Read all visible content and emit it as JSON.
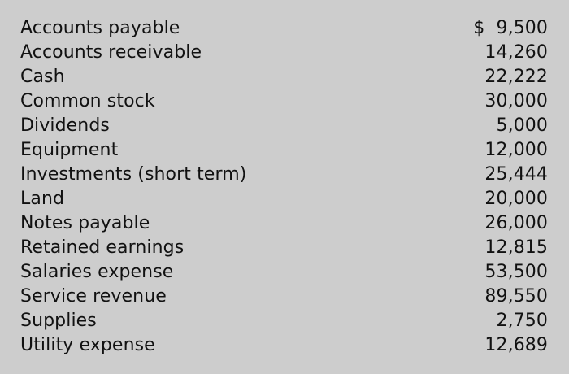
{
  "rows": [
    {
      "account": "Accounts payable",
      "amount": "$  9,500"
    },
    {
      "account": "Accounts receivable",
      "amount": "14,260"
    },
    {
      "account": "Cash",
      "amount": "22,222"
    },
    {
      "account": "Common stock",
      "amount": "30,000"
    },
    {
      "account": "Dividends",
      "amount": "5,000"
    },
    {
      "account": "Equipment",
      "amount": "12,000"
    },
    {
      "account": "Investments (short term)",
      "amount": "25,444"
    },
    {
      "account": "Land",
      "amount": "20,000"
    },
    {
      "account": "Notes payable",
      "amount": "26,000"
    },
    {
      "account": "Retained earnings",
      "amount": "12,815"
    },
    {
      "account": "Salaries expense",
      "amount": "53,500"
    },
    {
      "account": "Service revenue",
      "amount": "89,550"
    },
    {
      "account": "Supplies",
      "amount": "2,750"
    },
    {
      "account": "Utility expense",
      "amount": "12,689"
    }
  ]
}
